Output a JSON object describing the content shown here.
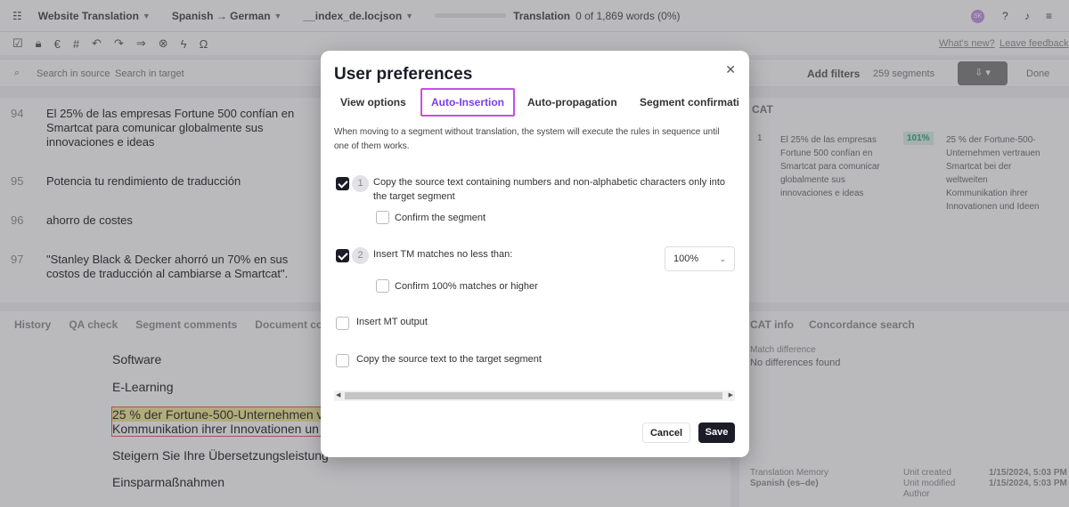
{
  "topbar": {
    "project": "Website Translation",
    "langpair": "Spanish → German",
    "file": "__index_de.locjson",
    "mode": "Translation",
    "progress": "0 of 1,869 words (0%)",
    "avatar": "SK"
  },
  "toolbar": {
    "whats_new": "What's new?",
    "feedback": "Leave feedback"
  },
  "filters": {
    "search_source": "Search in source",
    "search_target": "Search in target",
    "add_filters": "Add filters",
    "segment_count": "259 segments",
    "done": "Done"
  },
  "segments": [
    {
      "num": "94",
      "text": "El 25% de las empresas Fortune 500 confían en Smartcat para comunicar globalmente sus innovaciones e ideas"
    },
    {
      "num": "95",
      "text": "Potencia tu rendimiento de traducción"
    },
    {
      "num": "96",
      "text": "ahorro de costes"
    },
    {
      "num": "97",
      "text": "\"Stanley Black & Decker ahorró un 70% en sus costos de traducción al cambiarse a Smartcat\"."
    }
  ],
  "cat_panel": {
    "header": "CAT",
    "row_num": "1",
    "source": "El 25% de las empresas Fortune 500 confían en Smartcat para comunicar globalmente sus innovaciones e ideas",
    "match": "101%",
    "target": "25 % der Fortune-500-Unternehmen vertrauen Smartcat bei der weltweiten Kommunikation ihrer Innovationen und Ideen"
  },
  "bottom_tabs": [
    "History",
    "QA check",
    "Segment comments",
    "Document comm"
  ],
  "bottom_list": [
    "Software",
    "E-Learning",
    "25 % der Fortune-500-Unternehmen v",
    "Kommunikation ihrer Innovationen un",
    "Steigern Sie Ihre Übersetzungsleistung",
    "Einsparmaßnahmen"
  ],
  "right_bottom": {
    "tabs": [
      "CAT info",
      "Concordance search"
    ],
    "match_label": "Match difference",
    "match_value": "No differences found",
    "tm_label": "Translation Memory",
    "tm_lang": "Spanish (es–de)",
    "created_label": "Unit created",
    "modified_label": "Unit modified",
    "author_label": "Author",
    "created": "1/15/2024, 5:03 PM",
    "modified": "1/15/2024, 5:03 PM"
  },
  "modal": {
    "title": "User preferences",
    "tabs": [
      "View options",
      "Auto-Insertion",
      "Auto-propagation",
      "Segment confirmatic"
    ],
    "active_tab": "Auto-Insertion",
    "description": "When moving to a segment without translation, the system will execute the rules in sequence until one of them works.",
    "rules": [
      {
        "checked": true,
        "num": "1",
        "label": "Copy the source text containing numbers and non-alphabetic characters only into the target segment",
        "sub": "Confirm the segment",
        "sub_checked": false
      },
      {
        "checked": true,
        "num": "2",
        "label": "Insert TM matches no less than:",
        "value": "100%",
        "sub": "Confirm 100% matches or higher",
        "sub_checked": false
      },
      {
        "checked": false,
        "label": "Insert MT output"
      },
      {
        "checked": false,
        "label": "Copy the source text to the target segment"
      }
    ],
    "cancel": "Cancel",
    "save": "Save"
  }
}
